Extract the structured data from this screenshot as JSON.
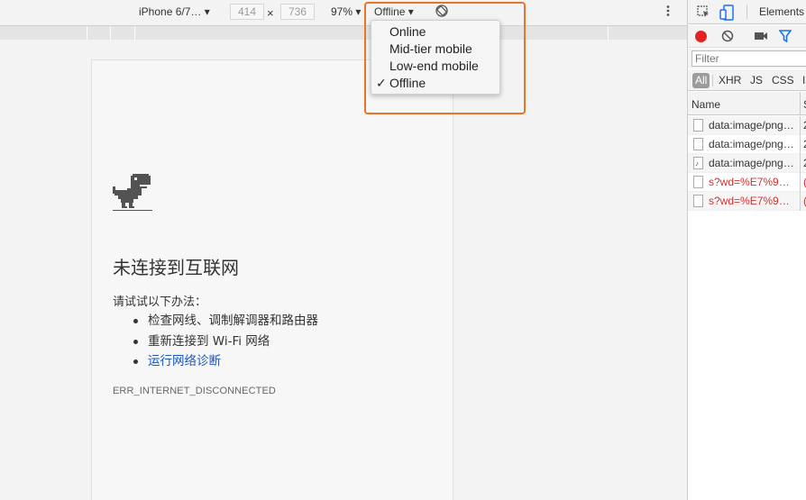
{
  "device_toolbar": {
    "device_label": "iPhone 6/7… ▾",
    "width_value": "414",
    "height_value": "736",
    "times": "×",
    "zoom": "97% ▾",
    "throttling_label": "Offline ▾",
    "rotate_icon": "rotate-icon",
    "more_icon": "more-vertical-icon"
  },
  "throttling_menu": {
    "options": [
      "Online",
      "Mid-tier mobile",
      "Low-end mobile",
      "Offline"
    ],
    "selected": "Offline",
    "check": "✓"
  },
  "error_page": {
    "title": "未连接到互联网",
    "try_text": "请试试以下办法：",
    "suggestions": [
      "检查网线、调制解调器和路由器",
      "重新连接到 Wi-Fi 网络",
      "运行网络诊断"
    ],
    "error_code": "ERR_INTERNET_DISCONNECTED",
    "link_color": "#1a56c2"
  },
  "devtools": {
    "tabs": {
      "elements": "Elements"
    },
    "filter_placeholder": "Filter",
    "type_filters": [
      "All",
      "XHR",
      "JS",
      "CSS",
      "I"
    ],
    "columns": {
      "name": "Name",
      "status": "S"
    },
    "requests": [
      {
        "name": "data:image/png…",
        "col2": "2",
        "type": "file",
        "error": false
      },
      {
        "name": "data:image/png…",
        "col2": "2",
        "type": "file",
        "error": false
      },
      {
        "name": "data:image/png…",
        "col2": "2",
        "type": "audio",
        "error": false
      },
      {
        "name": "s?wd=%E7%9…",
        "col2": "(",
        "type": "file",
        "error": true
      },
      {
        "name": "s?wd=%E7%9…",
        "col2": "(",
        "type": "file",
        "error": true
      }
    ],
    "record_color": "#e42020"
  },
  "highlight_color": "#e8742a"
}
